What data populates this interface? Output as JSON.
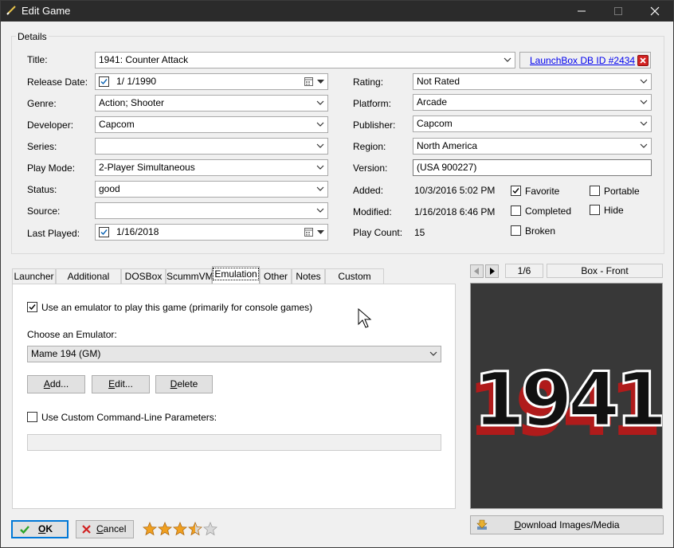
{
  "window": {
    "title": "Edit Game",
    "minimize_icon": "minimize-icon",
    "maximize_icon": "maximize-icon",
    "close_icon": "close-icon"
  },
  "details": {
    "group_label": "Details",
    "title_label": "Title:",
    "title_value": "1941: Counter Attack",
    "launchbox_link": "LaunchBox DB ID #2434",
    "release_date_label": "Release Date:",
    "release_date_value": "1/  1/1990",
    "release_date_checked": true,
    "genre_label": "Genre:",
    "genre_value": "Action; Shooter",
    "developer_label": "Developer:",
    "developer_value": "Capcom",
    "series_label": "Series:",
    "series_value": "",
    "play_mode_label": "Play Mode:",
    "play_mode_value": "2-Player Simultaneous",
    "status_label": "Status:",
    "status_value": "good",
    "source_label": "Source:",
    "source_value": "",
    "last_played_label": "Last Played:",
    "last_played_value": "1/16/2018",
    "last_played_checked": true,
    "rating_label": "Rating:",
    "rating_value": "Not Rated",
    "platform_label": "Platform:",
    "platform_value": "Arcade",
    "publisher_label": "Publisher:",
    "publisher_value": "Capcom",
    "region_label": "Region:",
    "region_value": "North America",
    "version_label": "Version:",
    "version_value": "(USA 900227)",
    "added_label": "Added:",
    "added_value": "10/3/2016 5:02 PM",
    "modified_label": "Modified:",
    "modified_value": "1/16/2018 6:46 PM",
    "play_count_label": "Play Count:",
    "play_count_value": "15",
    "flags": {
      "favorite": {
        "label": "Favorite",
        "checked": true
      },
      "portable": {
        "label": "Portable",
        "checked": false
      },
      "completed": {
        "label": "Completed",
        "checked": false
      },
      "hide": {
        "label": "Hide",
        "checked": false
      },
      "broken": {
        "label": "Broken",
        "checked": false
      }
    }
  },
  "tabs": [
    {
      "label": "Launcher",
      "active": false
    },
    {
      "label": "Additional Apps",
      "active": false
    },
    {
      "label": "DOSBox",
      "active": false
    },
    {
      "label": "ScummVM",
      "active": false
    },
    {
      "label": "Emulation",
      "active": true
    },
    {
      "label": "Other",
      "active": false
    },
    {
      "label": "Notes",
      "active": false
    },
    {
      "label": "Custom Fields",
      "active": false
    }
  ],
  "emulation": {
    "use_emulator_label": "Use an emulator to play this game (primarily for console games)",
    "use_emulator_checked": true,
    "choose_label": "Choose an Emulator:",
    "emulator_value": "Mame 194 (GM)",
    "add_button": "Add...",
    "edit_button": "Edit...",
    "delete_button": "Delete",
    "custom_params_label": "Use Custom Command-Line Parameters:",
    "custom_params_checked": false,
    "custom_params_value": ""
  },
  "media": {
    "counter": "1/6",
    "image_type": "Box - Front",
    "image_text": "1941",
    "download_button": "Download Images/Media"
  },
  "footer": {
    "ok_button": "OK",
    "cancel_button": "Cancel",
    "rating_stars": 3.5,
    "max_stars": 5
  },
  "colors": {
    "titlebar": "#2b2b2b",
    "accent": "#0078d7",
    "link": "#0000ee",
    "logo_red": "#d42b2b",
    "star_gold": "#f0a020"
  }
}
